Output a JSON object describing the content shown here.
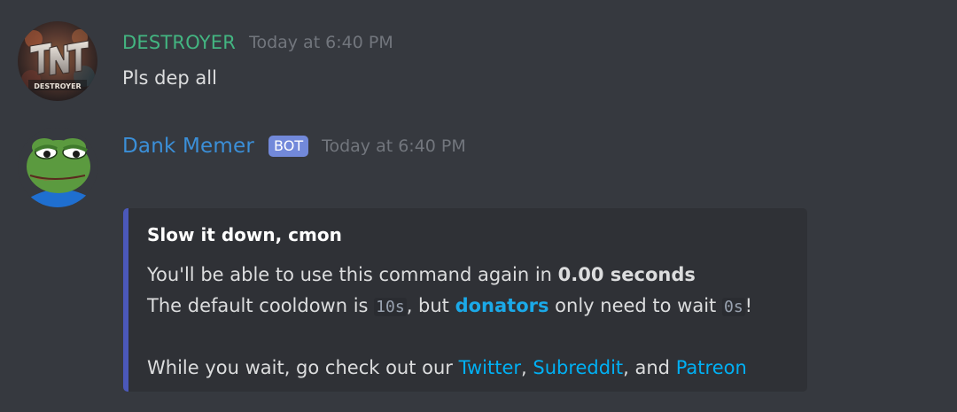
{
  "messages": [
    {
      "username": "DESTROYER",
      "username_color": "#43b581",
      "timestamp": "Today at 6:40 PM",
      "content": "Pls dep all",
      "avatar_text": "TNT"
    },
    {
      "username": "Dank Memer",
      "username_color": "#3b8fd8",
      "bot_tag": "BOT",
      "timestamp": "Today at 6:40 PM"
    }
  ],
  "embed": {
    "accent_color": "#4b58b9",
    "title": "Slow it down, cmon",
    "line1_prefix": "You'll be able to use this command again in ",
    "line1_value": "0.00 seconds",
    "line2_prefix": "The default cooldown is ",
    "line2_code1": "10s",
    "line2_mid": ", but ",
    "line2_link": "donators",
    "line2_after": " only need to wait ",
    "line2_code2": "0s",
    "line2_end": "!",
    "line3_prefix": "While you wait, go check out our ",
    "link_twitter": "Twitter",
    "sep1": ", ",
    "link_subreddit": "Subreddit",
    "sep2": ", and ",
    "link_patreon": "Patreon"
  }
}
